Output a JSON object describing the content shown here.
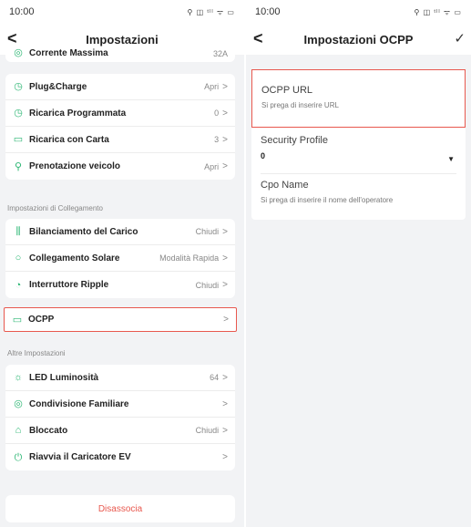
{
  "left": {
    "status": {
      "time": "10:00",
      "icons": "⚲ ◫ ᵗˡˡ ᯤ ▭"
    },
    "title": "Impostazioni",
    "partial_row": {
      "label": "Corrente Massima",
      "value": "32A"
    },
    "group1": [
      {
        "icon": "◷",
        "name": "plug-charge",
        "label": "Plug&Charge",
        "value": "Apri"
      },
      {
        "icon": "◷",
        "name": "scheduled-charge",
        "label": "Ricarica Programmata",
        "value": "0"
      },
      {
        "icon": "▭",
        "name": "card-charge",
        "label": "Ricarica con Carta",
        "value": "3"
      },
      {
        "icon": "⚲",
        "name": "vehicle-booking",
        "label": "Prenotazione veicolo",
        "value": "Apri"
      }
    ],
    "section_connection": "Impostazioni di Collegamento",
    "group2": [
      {
        "icon": "⫼",
        "name": "load-balancing",
        "label": "Bilanciamento del Carico",
        "value": "Chiudi"
      },
      {
        "icon": "○",
        "name": "solar-connection",
        "label": "Collegamento Solare",
        "value": "Modalità Rapida"
      },
      {
        "icon": "◔",
        "name": "ripple-switch",
        "label": "Interruttore Ripple",
        "value": "Chiudi"
      },
      {
        "icon": "▭",
        "name": "ocpp",
        "label": "OCPP",
        "value": ""
      }
    ],
    "section_other": "Altre Impostazioni",
    "group3": [
      {
        "icon": "☼",
        "name": "led-brightness",
        "label": "LED Luminosità",
        "value": "64"
      },
      {
        "icon": "◎",
        "name": "family-sharing",
        "label": "Condivisione Familiare",
        "value": ""
      },
      {
        "icon": "⌂",
        "name": "locked",
        "label": "Bloccato",
        "value": "Chiudi"
      },
      {
        "icon": "⏻",
        "name": "restart-charger",
        "label": "Riavvia il Caricatore EV",
        "value": ""
      }
    ],
    "disassocia": "Disassocia"
  },
  "right": {
    "status": {
      "time": "10:00",
      "icons": "⚲ ◫ ᵗˡˡ ᯤ ▭"
    },
    "title": "Impostazioni OCPP",
    "ocpp_url": {
      "label": "OCPP URL",
      "placeholder": "Si prega di inserire URL"
    },
    "security_profile": {
      "label": "Security Profile",
      "value": "0"
    },
    "cpo_name": {
      "label": "Cpo Name",
      "placeholder": "Si prega di inserire il nome dell'operatore"
    }
  },
  "colors": {
    "accent_green": "#2bb673",
    "highlight_red": "#e8584e"
  },
  "chevron": ">",
  "caret": "▼",
  "back": "<",
  "check": "✓"
}
